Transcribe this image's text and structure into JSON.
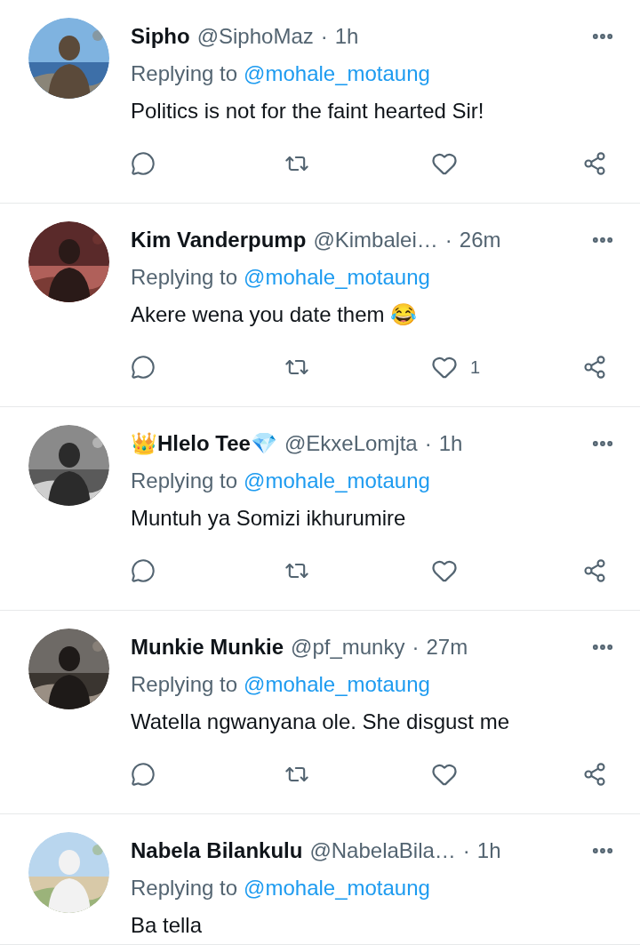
{
  "tweets": [
    {
      "name": "Sipho",
      "handle": "@SiphoMaz",
      "separator": "·",
      "time": "1h",
      "avatar": {
        "kind": "picture"
      },
      "replying_prefix": "Replying to",
      "replying_to": "@mohale_motaung",
      "text": "Politics is not for the faint hearted Sir!",
      "actions": [
        {
          "kind": "reply"
        },
        {
          "kind": "retweet"
        },
        {
          "kind": "like"
        },
        {
          "kind": "share"
        }
      ]
    },
    {
      "name": "Kim Vanderpump",
      "handle": "@Kimbalei…",
      "separator": "·",
      "time": "26m",
      "avatar": {
        "kind": "picture"
      },
      "replying_prefix": "Replying to",
      "replying_to": "@mohale_motaung",
      "text": "Akere wena you date them 😂",
      "actions": [
        {
          "kind": "reply"
        },
        {
          "kind": "retweet"
        },
        {
          "kind": "like",
          "count": "1"
        },
        {
          "kind": "share"
        }
      ]
    },
    {
      "name": "👑Hlelo Tee💎",
      "handle": "@EkxeLomjta",
      "separator": "·",
      "time": "1h",
      "avatar": {
        "kind": "picture"
      },
      "replying_prefix": "Replying to",
      "replying_to": "@mohale_motaung",
      "text": "Muntuh ya Somizi ikhurumire",
      "actions": [
        {
          "kind": "reply"
        },
        {
          "kind": "retweet"
        },
        {
          "kind": "like"
        },
        {
          "kind": "share"
        }
      ]
    },
    {
      "name": "Munkie Munkie",
      "handle": "@pf_munky",
      "separator": "·",
      "time": "27m",
      "avatar": {
        "kind": "picture"
      },
      "replying_prefix": "Replying to",
      "replying_to": "@mohale_motaung",
      "text": "Watella ngwanyana ole. She disgust me",
      "actions": [
        {
          "kind": "reply"
        },
        {
          "kind": "retweet"
        },
        {
          "kind": "like"
        },
        {
          "kind": "share"
        }
      ]
    },
    {
      "name": "Nabela Bilankulu",
      "handle": "@NabelaBila…",
      "separator": "·",
      "time": "1h",
      "avatar": {
        "kind": "picture"
      },
      "replying_prefix": "Replying to",
      "replying_to": "@mohale_motaung",
      "text": "Ba tella"
    }
  ]
}
